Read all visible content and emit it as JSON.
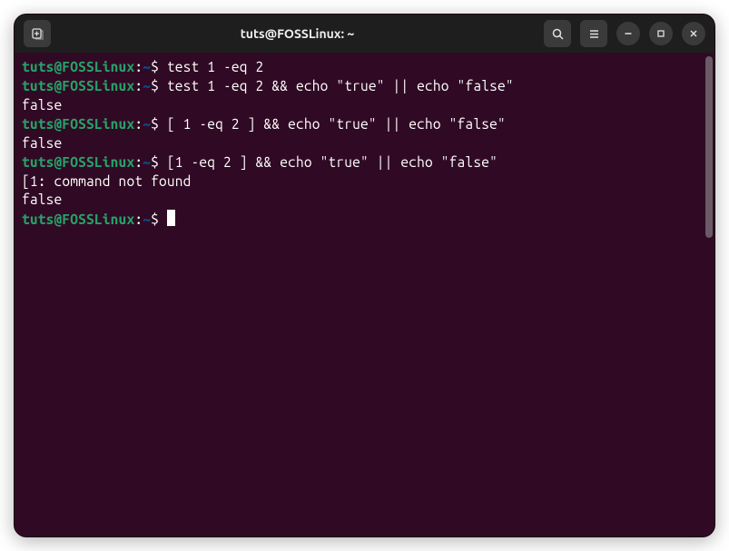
{
  "titlebar": {
    "title": "tuts@FOSSLinux: ~"
  },
  "prompt": {
    "user_host": "tuts@FOSSLinux",
    "colon": ":",
    "path": "~",
    "symbol": "$"
  },
  "lines": [
    {
      "type": "cmd",
      "command": "test 1 -eq 2"
    },
    {
      "type": "cmd",
      "command": "test 1 -eq 2 && echo \"true\" || echo \"false\""
    },
    {
      "type": "out",
      "text": "false"
    },
    {
      "type": "cmd",
      "command": "[ 1 -eq 2 ] && echo \"true\" || echo \"false\""
    },
    {
      "type": "out",
      "text": "false"
    },
    {
      "type": "cmd",
      "command": "[1 -eq 2 ] && echo \"true\" || echo \"false\""
    },
    {
      "type": "out",
      "text": "[1: command not found"
    },
    {
      "type": "out",
      "text": "false"
    },
    {
      "type": "cursor",
      "command": ""
    }
  ]
}
